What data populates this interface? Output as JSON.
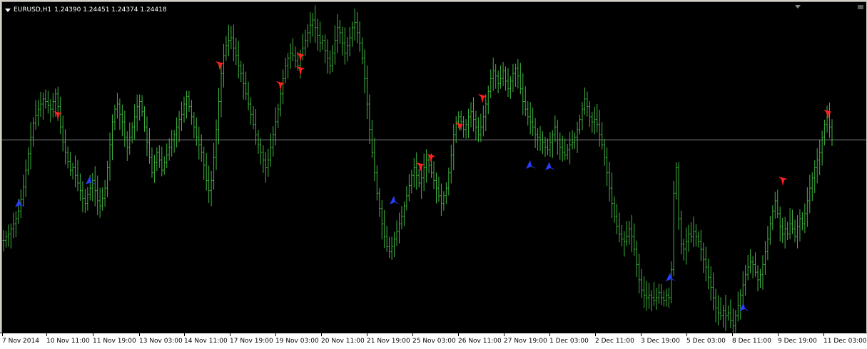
{
  "window": {
    "symbol": "EURUSD,H1",
    "ohlc": "1.24390 1.24451 1.24374 1.24418"
  },
  "colors": {
    "background": "#000000",
    "bars": "#3fb43f",
    "bid_line": "#8c8c8c",
    "sell_arrow": "#ff2020",
    "buy_arrow": "#2a3cff",
    "axis_bg": "#ffffff",
    "axis_text": "#000000"
  },
  "icons": {
    "symbol_menu": "triangle-down-icon",
    "sell_signal": "red-arrow-down-icon",
    "buy_signal": "blue-arrow-up-icon"
  },
  "time_axis": {
    "labels": [
      "7 Nov 2014",
      "10 Nov 11:00",
      "11 Nov 19:00",
      "13 Nov 03:00",
      "14 Nov 11:00",
      "17 Nov 19:00",
      "19 Nov 03:00",
      "20 Nov 11:00",
      "21 Nov 19:00",
      "25 Nov 03:00",
      "26 Nov 11:00",
      "27 Nov 19:00",
      "1 Dec 03:00",
      "2 Dec 11:00",
      "3 Dec 19:00",
      "5 Dec 03:00",
      "8 Dec 11:00",
      "9 Dec 19:00",
      "11 Dec 03:00"
    ]
  },
  "chart_data": {
    "type": "bar",
    "symbol": "EURUSD",
    "timeframe": "H1",
    "bid_line": 1.24418,
    "ylim": [
      1.229,
      1.255
    ],
    "series": [
      {
        "values": [
          1.2363,
          1.2366,
          1.2368,
          1.2372,
          1.2376,
          1.238,
          1.2386,
          1.2395,
          1.2405,
          1.2418,
          1.2431,
          1.2444,
          1.2455,
          1.2461,
          1.2466,
          1.247,
          1.2474,
          1.2472,
          1.2469,
          1.2466,
          1.2472,
          1.2478,
          1.2468,
          1.2452,
          1.244,
          1.2432,
          1.2425,
          1.2418,
          1.242,
          1.2414,
          1.2408,
          1.2402,
          1.2396,
          1.2392,
          1.2399,
          1.2404,
          1.241,
          1.2402,
          1.2394,
          1.239,
          1.2396,
          1.2404,
          1.242,
          1.2438,
          1.2456,
          1.2466,
          1.247,
          1.2462,
          1.2456,
          1.2444,
          1.2436,
          1.2444,
          1.2452,
          1.246,
          1.2468,
          1.2472,
          1.2464,
          1.2452,
          1.244,
          1.2428,
          1.2416,
          1.2424,
          1.2432,
          1.2426,
          1.2418,
          1.2424,
          1.243,
          1.2436,
          1.2442,
          1.2446,
          1.2452,
          1.2458,
          1.2462,
          1.247,
          1.2476,
          1.2468,
          1.246,
          1.2452,
          1.2444,
          1.2438,
          1.2432,
          1.2422,
          1.241,
          1.2402,
          1.241,
          1.2428,
          1.245,
          1.2472,
          1.2494,
          1.2508,
          1.2516,
          1.252,
          1.2522,
          1.2514,
          1.2508,
          1.25,
          1.2494,
          1.2486,
          1.2478,
          1.247,
          1.2462,
          1.2454,
          1.2446,
          1.2438,
          1.2432,
          1.2426,
          1.242,
          1.2426,
          1.2436,
          1.2446,
          1.2456,
          1.2466,
          1.2478,
          1.249,
          1.25,
          1.2506,
          1.251,
          1.2508,
          1.2504,
          1.25,
          1.2508,
          1.2514,
          1.252,
          1.2526,
          1.2532,
          1.2536,
          1.253,
          1.2524,
          1.2518,
          1.252,
          1.2512,
          1.2506,
          1.25,
          1.251,
          1.252,
          1.253,
          1.2526,
          1.2518,
          1.251,
          1.2516,
          1.2522,
          1.253,
          1.2534,
          1.2526,
          1.2518,
          1.2506,
          1.249,
          1.247,
          1.245,
          1.2432,
          1.2416,
          1.24,
          1.2388,
          1.2376,
          1.2366,
          1.2358,
          1.2354,
          1.2358,
          1.2364,
          1.237,
          1.2376,
          1.2382,
          1.239,
          1.2398,
          1.2406,
          1.2414,
          1.242,
          1.2414,
          1.2408,
          1.2412,
          1.242,
          1.2426,
          1.2422,
          1.2416,
          1.241,
          1.2404,
          1.2398,
          1.2392,
          1.2398,
          1.2404,
          1.2416,
          1.243,
          1.2446,
          1.2456,
          1.246,
          1.2456,
          1.245,
          1.2454,
          1.246,
          1.2464,
          1.2458,
          1.2452,
          1.2446,
          1.2452,
          1.246,
          1.247,
          1.248,
          1.249,
          1.2496,
          1.2492,
          1.2486,
          1.249,
          1.2496,
          1.2488,
          1.2482,
          1.2488,
          1.2494,
          1.2498,
          1.2492,
          1.2482,
          1.2472,
          1.2466,
          1.246,
          1.2456,
          1.2452,
          1.2446,
          1.2444,
          1.2442,
          1.244,
          1.2436,
          1.2434,
          1.244,
          1.2446,
          1.2452,
          1.2442,
          1.2436,
          1.2432,
          1.243,
          1.2434,
          1.2438,
          1.244,
          1.2444,
          1.245,
          1.2458,
          1.2466,
          1.2474,
          1.2468,
          1.246,
          1.2456,
          1.2458,
          1.2454,
          1.2446,
          1.2438,
          1.2428,
          1.2416,
          1.2404,
          1.2392,
          1.2382,
          1.2374,
          1.2368,
          1.2364,
          1.2362,
          1.2366,
          1.2372,
          1.2366,
          1.2356,
          1.2344,
          1.2332,
          1.2324,
          1.232,
          1.2318,
          1.232,
          1.2318,
          1.2316,
          1.2318,
          1.2322,
          1.2318,
          1.2316,
          1.232,
          1.2318,
          1.234,
          1.24,
          1.242,
          1.238,
          1.236,
          1.2356,
          1.2362,
          1.2368,
          1.2366,
          1.237,
          1.2366,
          1.2362,
          1.2356,
          1.2348,
          1.2342,
          1.2334,
          1.2326,
          1.2318,
          1.231,
          1.2306,
          1.2304,
          1.2308,
          1.2304,
          1.2306,
          1.23,
          1.2296,
          1.2304,
          1.2312,
          1.232,
          1.2328,
          1.2336,
          1.2342,
          1.2346,
          1.2344,
          1.2338,
          1.2332,
          1.2336,
          1.2344,
          1.2354,
          1.2364,
          1.2376,
          1.2386,
          1.2394,
          1.2384,
          1.2374,
          1.2368,
          1.2372,
          1.2368,
          1.2376,
          1.2372,
          1.2366,
          1.2374,
          1.238,
          1.2376,
          1.2384,
          1.2394,
          1.2404,
          1.2412,
          1.242,
          1.2426,
          1.2432,
          1.2444,
          1.2454,
          1.246,
          1.2452,
          1.2442
        ]
      }
    ]
  }
}
